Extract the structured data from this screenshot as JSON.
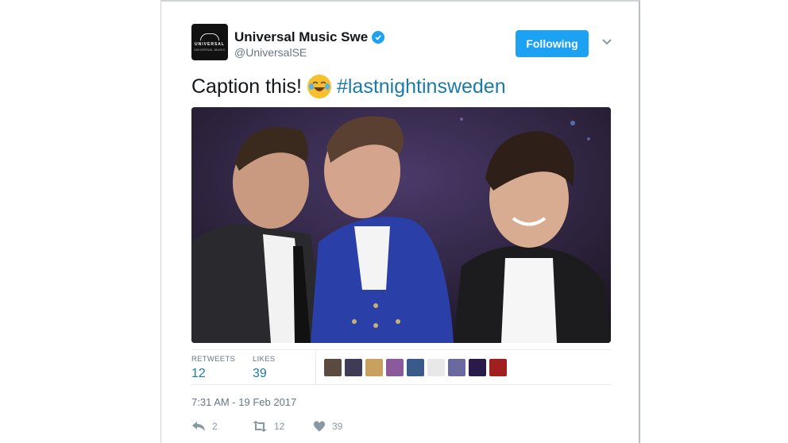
{
  "account": {
    "name": "Universal Music Swe",
    "handle": "@UniversalSE",
    "avatar_text": "UNIVERSAL",
    "avatar_subtext": "UNIVERSAL MUSIC"
  },
  "follow_button": {
    "label": "Following"
  },
  "tweet": {
    "text": "Caption this!",
    "emoji": "face-with-tears-of-joy",
    "hashtag": "#lastnightinsweden"
  },
  "stats": {
    "retweets_label": "RETWEETS",
    "retweets_value": "12",
    "likes_label": "LIKES",
    "likes_value": "39"
  },
  "likers": [
    {
      "name": "liker-1",
      "color": "#5a4a3f"
    },
    {
      "name": "liker-2",
      "color": "#3f3a55"
    },
    {
      "name": "liker-3",
      "color": "#c8a060"
    },
    {
      "name": "liker-4",
      "color": "#8a5a9a"
    },
    {
      "name": "liker-5",
      "color": "#3a5a8a"
    },
    {
      "name": "liker-6",
      "color": "#e8e8e8"
    },
    {
      "name": "liker-7",
      "color": "#6a6aa0"
    },
    {
      "name": "liker-8",
      "color": "#2a1a4a"
    },
    {
      "name": "liker-9",
      "color": "#a02020"
    }
  ],
  "timestamp": "7:31 AM - 19 Feb 2017",
  "actions": {
    "reply_count": "2",
    "retweet_count": "12",
    "like_count": "39"
  },
  "colors": {
    "accent": "#1da1f2",
    "link": "#1b7aa8",
    "muted": "#657786"
  }
}
